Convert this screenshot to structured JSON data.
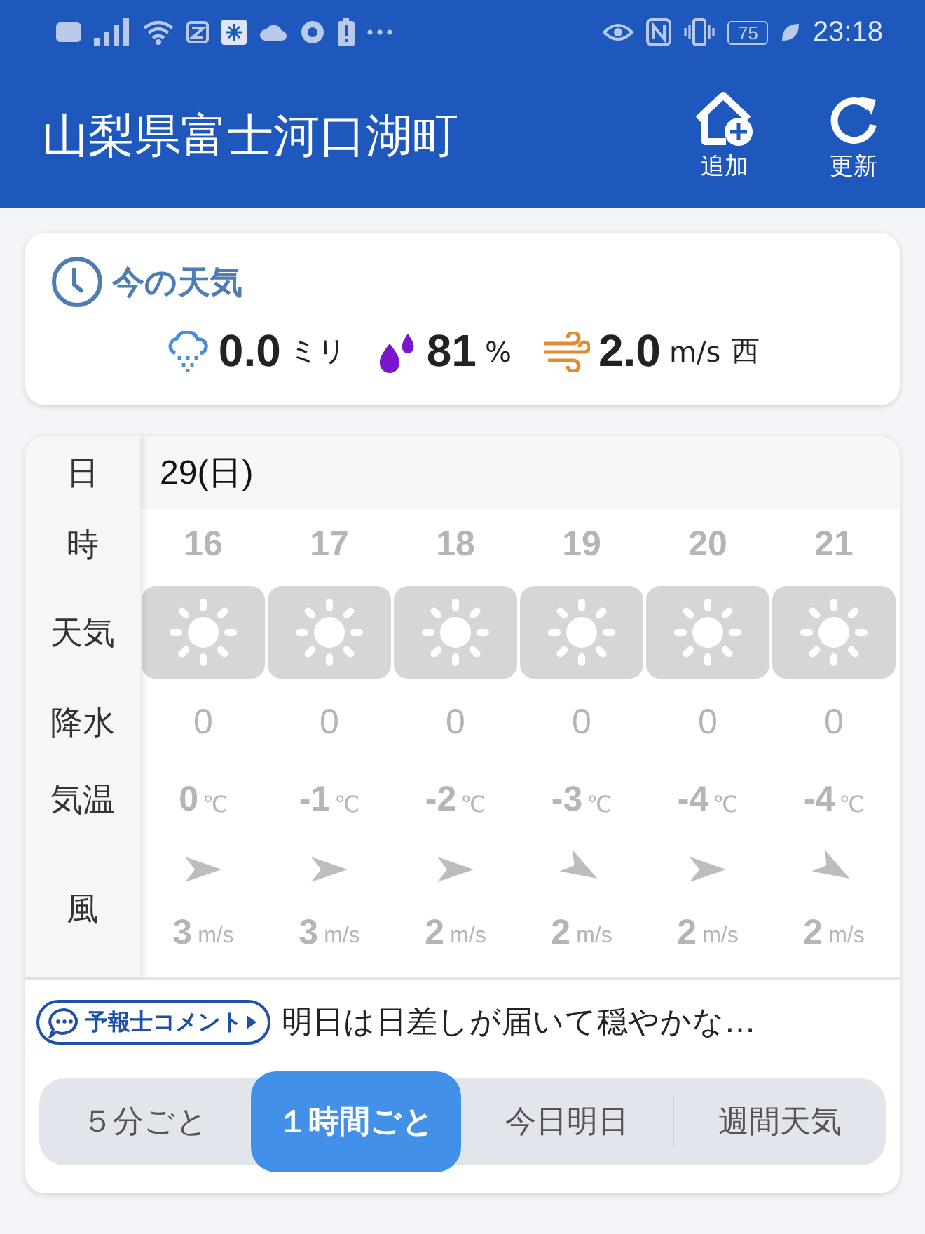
{
  "status_bar": {
    "battery": "75",
    "time": "23:18"
  },
  "header": {
    "title": "山梨県富士河口湖町",
    "actions": [
      {
        "kind": "add",
        "label": "追加"
      },
      {
        "kind": "refresh",
        "label": "更新"
      }
    ]
  },
  "current": {
    "title": "今の天気",
    "rain": {
      "value": "0.0",
      "unit": "ミリ"
    },
    "humidity": {
      "value": "81",
      "unit": "%"
    },
    "wind": {
      "value": "2.0",
      "unit": "m/s",
      "direction": "西"
    }
  },
  "hourly": {
    "labels": {
      "date": "日",
      "hour": "時",
      "weather": "天気",
      "precip": "降水",
      "temp": "気温",
      "wind": "風"
    },
    "date": "29(日)",
    "hours": [
      {
        "hour": "16",
        "weather": {
          "kind": "sunny"
        },
        "precip": "0",
        "temp": "0",
        "temp_unit": "℃",
        "arrow": {
          "kind": "right"
        },
        "wind": "3",
        "wind_unit": "m/s"
      },
      {
        "hour": "17",
        "weather": {
          "kind": "sunny"
        },
        "precip": "0",
        "temp": "-1",
        "temp_unit": "℃",
        "arrow": {
          "kind": "right"
        },
        "wind": "3",
        "wind_unit": "m/s"
      },
      {
        "hour": "18",
        "weather": {
          "kind": "sunny"
        },
        "precip": "0",
        "temp": "-2",
        "temp_unit": "℃",
        "arrow": {
          "kind": "right"
        },
        "wind": "2",
        "wind_unit": "m/s"
      },
      {
        "hour": "19",
        "weather": {
          "kind": "sunny"
        },
        "precip": "0",
        "temp": "-3",
        "temp_unit": "℃",
        "arrow": {
          "kind": "downright"
        },
        "wind": "2",
        "wind_unit": "m/s"
      },
      {
        "hour": "20",
        "weather": {
          "kind": "sunny"
        },
        "precip": "0",
        "temp": "-4",
        "temp_unit": "℃",
        "arrow": {
          "kind": "right"
        },
        "wind": "2",
        "wind_unit": "m/s"
      },
      {
        "hour": "21",
        "weather": {
          "kind": "sunny"
        },
        "precip": "0",
        "temp": "-4",
        "temp_unit": "℃",
        "arrow": {
          "kind": "downright"
        },
        "wind": "2",
        "wind_unit": "m/s"
      }
    ]
  },
  "comment": {
    "button": "予報士コメント",
    "text": "明日は日差しが届いて穏やかな…"
  },
  "tabs": [
    {
      "label": "５分ごと",
      "selected": false
    },
    {
      "label": "１時間ごと",
      "selected": true
    },
    {
      "label": "今日明日",
      "selected": false
    },
    {
      "label": "週間天気",
      "selected": false
    }
  ]
}
